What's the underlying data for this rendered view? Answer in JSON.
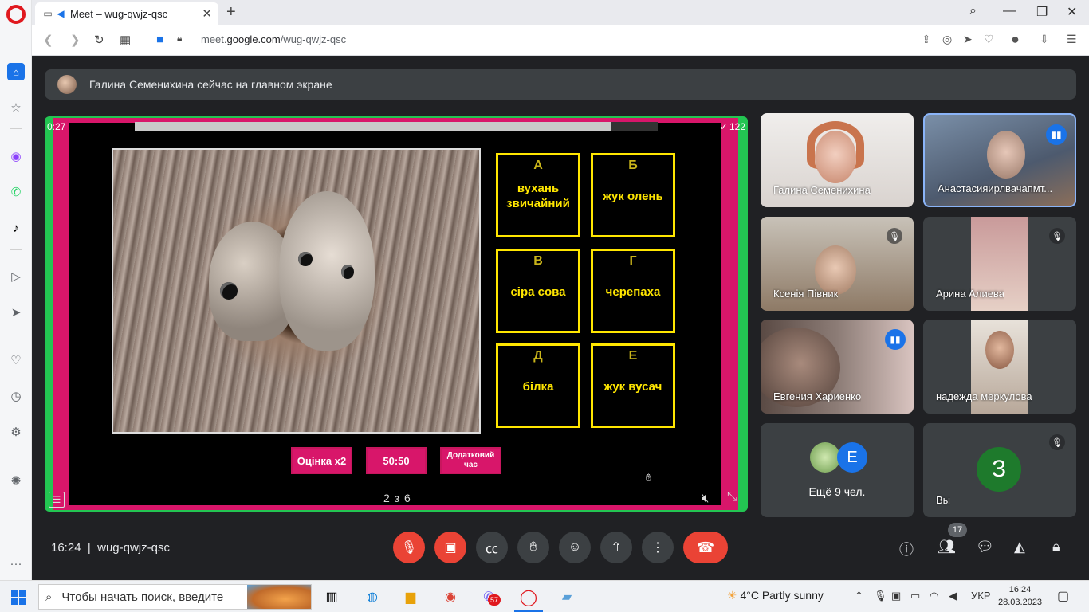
{
  "browser": {
    "tab_title": "Meet – wug-qwjz-qsc",
    "url_prefix": "meet.",
    "url_domain": "google.com",
    "url_path": "/wug-qwjz-qsc"
  },
  "banner": {
    "text": "Галина Семенихина сейчас на главном экране"
  },
  "quiz": {
    "timer": "0:27",
    "score": "122",
    "progress": 0.91,
    "answers": [
      {
        "letter": "А",
        "text": "вухань звичайний"
      },
      {
        "letter": "Б",
        "text": "жук олень"
      },
      {
        "letter": "В",
        "text": "сіра сова"
      },
      {
        "letter": "Г",
        "text": "черепаха"
      },
      {
        "letter": "Д",
        "text": "білка"
      },
      {
        "letter": "Е",
        "text": "жук вусач"
      }
    ],
    "lifelines": [
      "Оцінка x2",
      "50:50",
      "Додатковий час"
    ],
    "page_indicator": "2 з 6"
  },
  "participants": [
    {
      "name": "Галина Семенихина",
      "muted": false,
      "speaking": false
    },
    {
      "name": "Анастасияирлвачапмт...",
      "muted": false,
      "speaking": true
    },
    {
      "name": "Ксенія Півник",
      "muted": true,
      "speaking": false
    },
    {
      "name": "Арина Алиева",
      "muted": true,
      "speaking": false
    },
    {
      "name": "Евгения Хариенко",
      "muted": false,
      "speaking": true
    },
    {
      "name": "надежда меркулова",
      "muted": false,
      "speaking": false
    }
  ],
  "others": {
    "label": "Ещё 9 чел.",
    "avatar_letter": "E"
  },
  "self": {
    "name": "Вы",
    "avatar_letter": "З"
  },
  "meeting": {
    "time": "16:24",
    "code": "wug-qwjz-qsc",
    "people_count": "17"
  },
  "taskbar": {
    "search_placeholder": "Чтобы начать поиск, введите",
    "weather": "4°C  Partly sunny",
    "lang": "УКР",
    "time": "16:24",
    "date": "28.03.2023",
    "viber_badge": "57"
  },
  "colors": {
    "frame_pink": "#d8166a",
    "frame_green": "#23c552",
    "answer_yellow": "#ffe600",
    "meet_red": "#ea4335",
    "meet_bg": "#202124"
  }
}
